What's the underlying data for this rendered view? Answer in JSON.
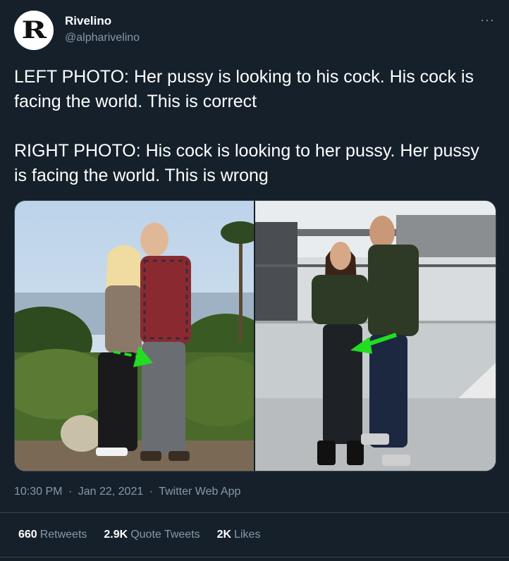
{
  "user": {
    "display_name": "Rivelino",
    "handle": "@alpharivelino",
    "avatar_letter": "R"
  },
  "menu": {
    "more_label": "···"
  },
  "tweet": {
    "paragraph_1": "LEFT PHOTO: Her pussy is looking to his cock. His cock is facing the world. This is correct",
    "paragraph_2": "RIGHT PHOTO: His cock is looking to her pussy. Her pussy is facing the world. This is wrong"
  },
  "media": {
    "left_photo_icon": "photo-couple-outdoor",
    "right_photo_icon": "photo-couple-mall",
    "arrow_color": "#22dd22"
  },
  "meta": {
    "time": "10:30 PM",
    "date": "Jan 22, 2021",
    "source": "Twitter Web App"
  },
  "stats": {
    "retweets_count": "660",
    "retweets_label": "Retweets",
    "quotes_count": "2.9K",
    "quotes_label": "Quote Tweets",
    "likes_count": "2K",
    "likes_label": "Likes"
  },
  "colors": {
    "background": "#15202b",
    "secondary_text": "#8899a6",
    "border": "#38444d"
  }
}
